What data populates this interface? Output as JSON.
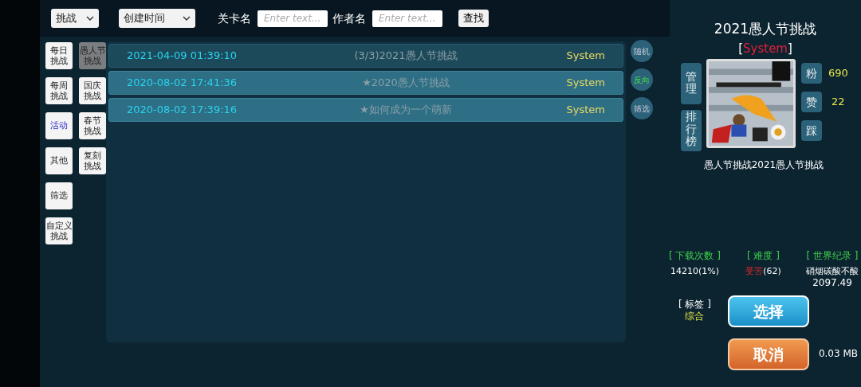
{
  "filters": {
    "type_select": "挑战",
    "sort_select": "创建时间",
    "level_name": {
      "label": "关卡名",
      "placeholder": "Enter text..."
    },
    "author_name": {
      "label": "作者名",
      "placeholder": "Enter text..."
    },
    "search_button": "查找"
  },
  "categories_left": [
    {
      "label": "每日挑战",
      "selected": false,
      "highlighted": false
    },
    {
      "label": "每周挑战",
      "selected": false,
      "highlighted": false
    },
    {
      "label": "活动",
      "selected": false,
      "highlighted": true
    },
    {
      "label": "其他",
      "selected": false,
      "highlighted": false
    },
    {
      "label": "筛选",
      "selected": false,
      "highlighted": false
    },
    {
      "label": "自定义挑战",
      "selected": false,
      "highlighted": false
    }
  ],
  "categories_right": [
    {
      "label": "愚人节挑战",
      "selected": true,
      "highlighted": false
    },
    {
      "label": "国庆挑战",
      "selected": false,
      "highlighted": false
    },
    {
      "label": "春节挑战",
      "selected": false,
      "highlighted": false
    },
    {
      "label": "复刻挑战",
      "selected": false,
      "highlighted": false
    }
  ],
  "rows": [
    {
      "time": "2021-04-09 01:39:10",
      "name": "(3/3)2021愚人节挑战",
      "author": "System",
      "selected": true
    },
    {
      "time": "2020-08-02 17:41:36",
      "name": "★2020愚人节挑战",
      "author": "System",
      "selected": false
    },
    {
      "time": "2020-08-02 17:39:16",
      "name": "★如何成为一个萌新",
      "author": "System",
      "selected": false
    }
  ],
  "side_buttons": [
    {
      "label": "随机",
      "on": false
    },
    {
      "label": "反向",
      "on": true
    },
    {
      "label": "筛选",
      "on": false
    }
  ],
  "detail": {
    "title": "2021愚人节挑战",
    "author": "[**System**]",
    "manage_button": "管理",
    "ranking_button": "排行榜",
    "fans": {
      "button": "粉",
      "count": "690"
    },
    "likes": {
      "button": "赞",
      "count": "22"
    },
    "dislike_button": "踩",
    "caption": "愚人节挑战2021愚人节挑战",
    "stats": [
      {
        "header": "[ 下载次数 ]",
        "value": "14210(1%)"
      },
      {
        "header": "[ 难度 ]",
        "value": "**受苦**(62)"
      },
      {
        "header": "[ 世界纪录 ]",
        "value": "硝烟碳酸不酸",
        "value2": "2097.49"
      }
    ],
    "tag": {
      "header": "[ 标签 ]",
      "value": "综合"
    },
    "select_button": "选择",
    "cancel_button": "取消",
    "size": "0.03 MB"
  }
}
